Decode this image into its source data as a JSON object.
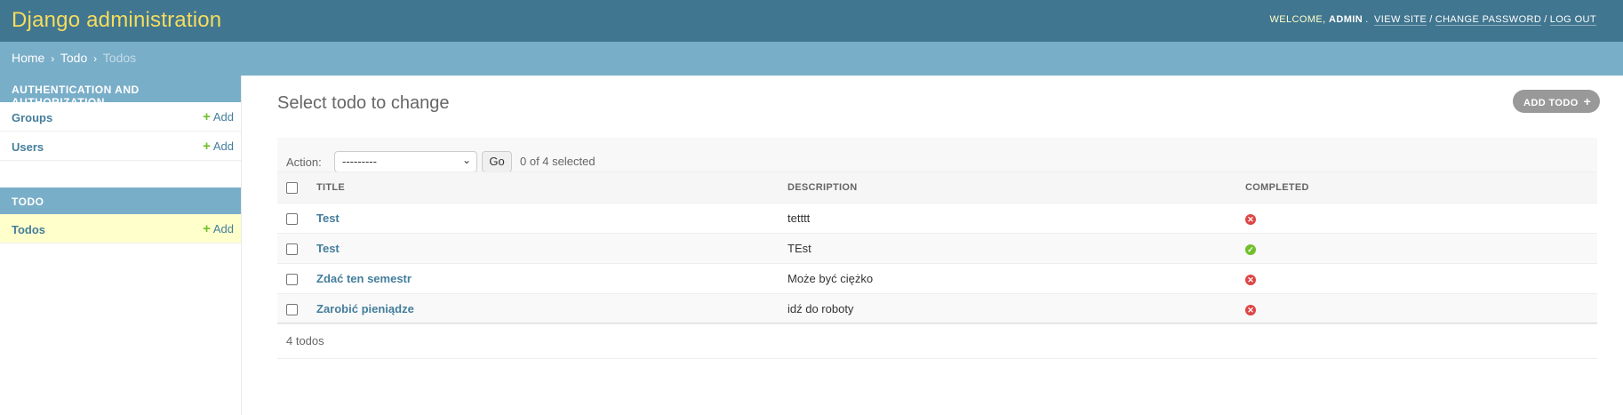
{
  "header": {
    "branding": "Django administration",
    "welcome": "Welcome,",
    "user_name": "admin",
    "view_site": "View site",
    "change_password": "Change password",
    "log_out": "Log out"
  },
  "breadcrumbs": {
    "home": "Home",
    "app": "Todo",
    "current": "Todos",
    "separator": "›"
  },
  "sidebar": {
    "modules": [
      {
        "caption": "Authentication and Authorization",
        "models": [
          {
            "label": "Groups",
            "add_label": "Add"
          },
          {
            "label": "Users",
            "add_label": "Add"
          }
        ]
      },
      {
        "caption": "Todo",
        "models": [
          {
            "label": "Todos",
            "add_label": "Add",
            "current": true
          }
        ]
      }
    ]
  },
  "content": {
    "title": "Select todo to change",
    "add_button": "Add todo",
    "actions": {
      "label": "Action:",
      "selected_option": "---------",
      "go_label": "Go",
      "selected_count": "0 of 4 selected"
    },
    "table": {
      "headers": [
        "Title",
        "Description",
        "Completed"
      ],
      "rows": [
        {
          "title": "Test",
          "description": "tetttt",
          "completed": false
        },
        {
          "title": "Test",
          "description": "TEst",
          "completed": true
        },
        {
          "title": "Zdać ten semestr",
          "description": "Może być ciężko",
          "completed": false
        },
        {
          "title": "Zarobić pieniądze",
          "description": "idź do roboty",
          "completed": false
        }
      ]
    },
    "paginator": "4 todos"
  },
  "colors": {
    "header_bg": "#417690",
    "branding": "#f5dd5d",
    "breadcrumbs_bg": "#79aec8",
    "link": "#447e9b",
    "add_plus": "#70bf2b",
    "status_no": "#dd4646",
    "status_yes": "#70bf2b",
    "current_model_bg": "#ffffcc"
  }
}
